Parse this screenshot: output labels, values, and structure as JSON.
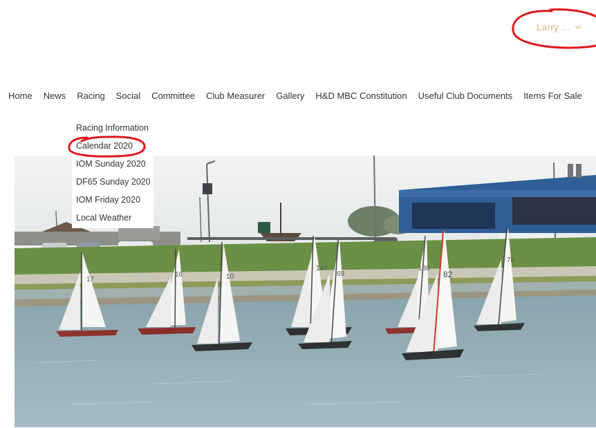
{
  "user_menu": {
    "name": "Larry ..."
  },
  "nav": {
    "items": [
      "Home",
      "News",
      "Racing",
      "Social",
      "Committee",
      "Club Measurer",
      "Gallery",
      "H&D MBC Constitution",
      "Useful Club Documents",
      "Items For Sale"
    ]
  },
  "dropdown": {
    "items": [
      "Racing Information",
      "Calendar 2020",
      "IOM Sunday 2020",
      "DF65 Sunday 2020",
      "IOM Friday 2020",
      "Local Weather"
    ]
  },
  "photo": {
    "sail_numbers": [
      "17",
      "16",
      "10",
      "147",
      "69",
      "180",
      "82",
      "78"
    ]
  },
  "colors": {
    "annotation_red": "#e0161b",
    "user_menu": "#d8b482",
    "nav_text": "#333333"
  }
}
